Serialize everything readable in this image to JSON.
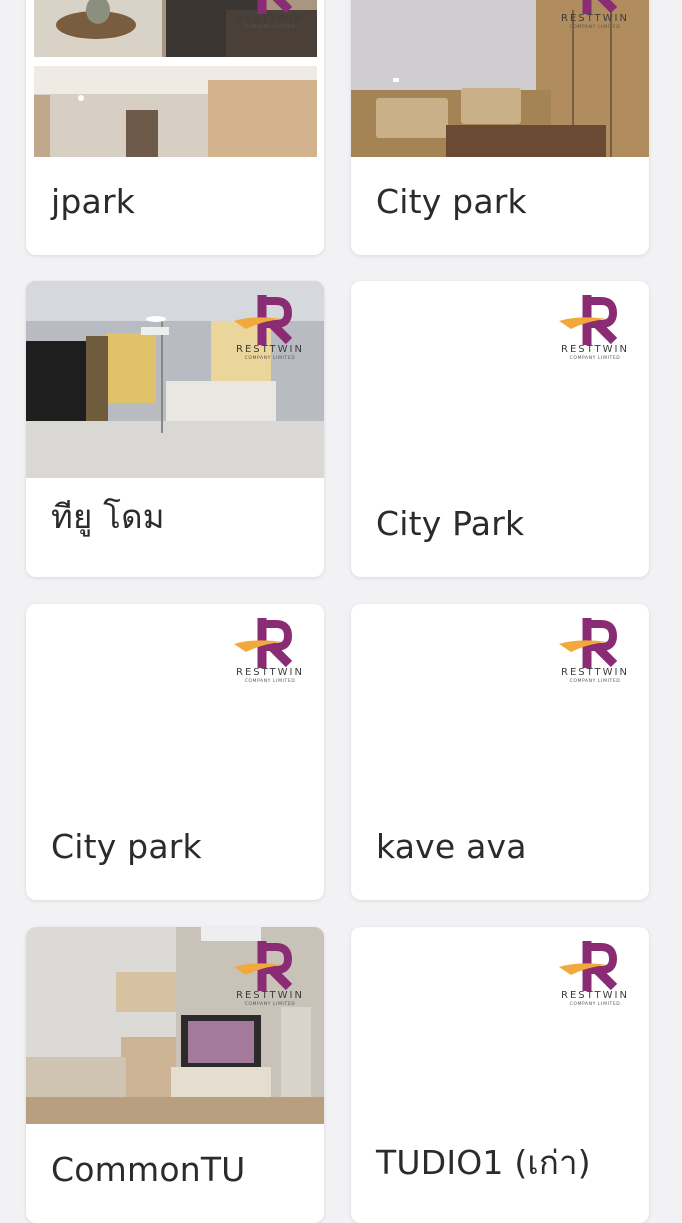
{
  "brand": {
    "name": "RESTTWIN",
    "subtitle": "COMPANY LIMITED",
    "letter": "R",
    "primary_color": "#8a2c73",
    "accent_color": "#f2a93b"
  },
  "listings": [
    {
      "title": "jpark",
      "image": "room-photo"
    },
    {
      "title": "City park",
      "image": "room-photo"
    },
    {
      "title": "ทียู โดม",
      "image": "room-photo"
    },
    {
      "title": "City Park",
      "image": "logo-placeholder"
    },
    {
      "title": "City park",
      "image": "logo-placeholder"
    },
    {
      "title": "kave ava",
      "image": "logo-placeholder"
    },
    {
      "title": "CommonTU",
      "image": "room-photo"
    },
    {
      "title": "TUDIO1 (เก่า)",
      "image": "logo-placeholder"
    }
  ]
}
